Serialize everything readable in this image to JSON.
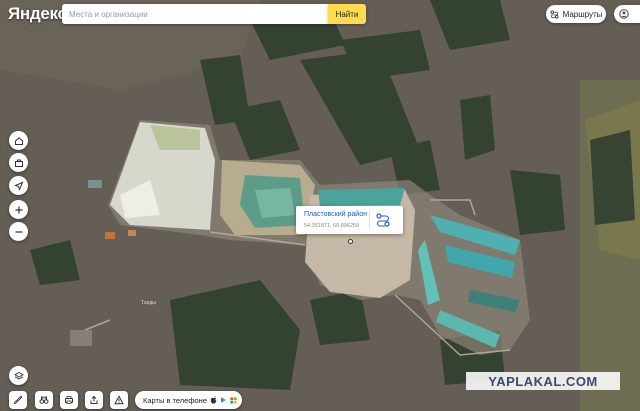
{
  "header": {
    "logo_text": "Яндекс",
    "search_placeholder": "Места и организации",
    "find_label": "Найти",
    "routes_label": "Маршруты"
  },
  "popup": {
    "title": "Пластовский район",
    "coords": "54.351871, 60.896259"
  },
  "map": {
    "town_label": "Танды"
  },
  "bottom": {
    "phone_label": "Карты в телефоне"
  },
  "watermark": "YAPLAKAL.COM",
  "icons": {
    "home": "home-icon",
    "work": "briefcase-icon",
    "location": "location-arrow-icon",
    "zoom_in": "plus-icon",
    "zoom_out": "minus-icon",
    "layers": "layers-icon",
    "ruler": "ruler-icon",
    "panorama": "binoculars-icon",
    "print": "printer-icon",
    "share": "share-icon",
    "report": "warning-icon"
  },
  "colors": {
    "accent": "#ffdb4d",
    "link": "#1a5ecc"
  }
}
